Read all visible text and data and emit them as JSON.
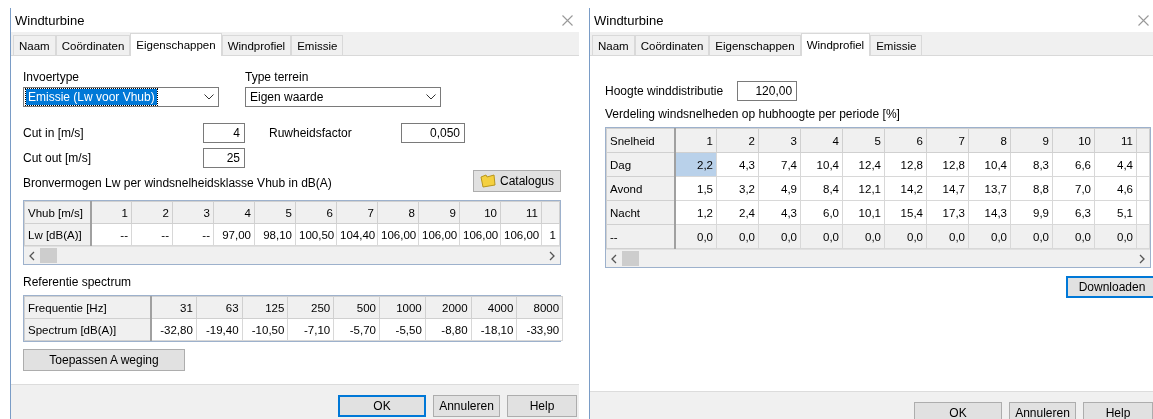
{
  "windows": [
    {
      "kind": "eigenschappen",
      "title": "Windturbine",
      "tabs": [
        {
          "label": "Naam",
          "selected": false
        },
        {
          "label": "Coördinaten",
          "selected": false
        },
        {
          "label": "Eigenschappen",
          "selected": true
        },
        {
          "label": "Windprofiel",
          "selected": false
        },
        {
          "label": "Emissie",
          "selected": false
        }
      ],
      "invoertype": {
        "label": "Invoertype",
        "value": "Emissie (Lw voor Vhub)",
        "focused": true
      },
      "type_terrein": {
        "label": "Type terrein",
        "value": "Eigen waarde",
        "focused": false
      },
      "cut_in": {
        "label": "Cut in [m/s]",
        "value": "4"
      },
      "ruwheidsfactor": {
        "label": "Ruwheidsfactor",
        "value": "0,050"
      },
      "cut_out": {
        "label": "Cut out [m/s]",
        "value": "25"
      },
      "bronvermogen_label": "Bronvermogen Lw per windsnelheidsklasse Vhub in dB(A)",
      "catalogus_button": "Catalogus",
      "lw_table": {
        "columns": [
          "Vhub [m/s]",
          "1",
          "2",
          "3",
          "4",
          "5",
          "6",
          "7",
          "8",
          "9",
          "10",
          "11"
        ],
        "rows": [
          {
            "label": "Lw [dB(A)]",
            "values": [
              "--",
              "--",
              "--",
              "97,00",
              "98,10",
              "100,50",
              "104,40",
              "106,00",
              "106,00",
              "106,00",
              "106,00",
              "1"
            ]
          }
        ]
      },
      "spectrum_label": "Referentie spectrum",
      "spectrum_table": {
        "columns": [
          "Frequentie [Hz]",
          "31",
          "63",
          "125",
          "250",
          "500",
          "1000",
          "2000",
          "4000",
          "8000"
        ],
        "rows": [
          {
            "label": "Spectrum [dB(A)]",
            "values": [
              "-32,80",
              "-19,40",
              "-10,50",
              "-7,10",
              "-5,70",
              "-5,50",
              "-8,80",
              "-18,10",
              "-33,90"
            ]
          }
        ]
      },
      "toepassen_button": "Toepassen A weging",
      "buttons": [
        {
          "label": "OK",
          "default": true
        },
        {
          "label": "Annuleren",
          "default": false
        },
        {
          "label": "Help",
          "default": false
        }
      ]
    },
    {
      "kind": "windprofiel",
      "title": "Windturbine",
      "tabs": [
        {
          "label": "Naam",
          "selected": false
        },
        {
          "label": "Coördinaten",
          "selected": false
        },
        {
          "label": "Eigenschappen",
          "selected": false
        },
        {
          "label": "Windprofiel",
          "selected": true
        },
        {
          "label": "Emissie",
          "selected": false
        }
      ],
      "hoogte": {
        "label": "Hoogte winddistributie",
        "value": "120,00"
      },
      "verdeling_label": "Verdeling windsnelheden op hubhoogte per periode [%]",
      "table": {
        "columns": [
          "Snelheid",
          "1",
          "2",
          "3",
          "4",
          "5",
          "6",
          "7",
          "8",
          "9",
          "10",
          "11"
        ],
        "rows": [
          {
            "label": "Dag",
            "kind": "data",
            "values": [
              {
                "text": "2,2",
                "selected": true
              },
              {
                "text": "4,3",
                "selected": false
              },
              {
                "text": "7,4",
                "selected": false
              },
              {
                "text": "10,4",
                "selected": false
              },
              {
                "text": "12,4",
                "selected": false
              },
              {
                "text": "12,8",
                "selected": false
              },
              {
                "text": "12,8",
                "selected": false
              },
              {
                "text": "10,4",
                "selected": false
              },
              {
                "text": "8,3",
                "selected": false
              },
              {
                "text": "6,6",
                "selected": false
              },
              {
                "text": "4,4",
                "selected": false
              }
            ]
          },
          {
            "label": "Avond",
            "kind": "data",
            "values": [
              {
                "text": "1,5",
                "selected": false
              },
              {
                "text": "3,2",
                "selected": false
              },
              {
                "text": "4,9",
                "selected": false
              },
              {
                "text": "8,4",
                "selected": false
              },
              {
                "text": "12,1",
                "selected": false
              },
              {
                "text": "14,2",
                "selected": false
              },
              {
                "text": "14,7",
                "selected": false
              },
              {
                "text": "13,7",
                "selected": false
              },
              {
                "text": "8,8",
                "selected": false
              },
              {
                "text": "7,0",
                "selected": false
              },
              {
                "text": "4,6",
                "selected": false
              }
            ]
          },
          {
            "label": "Nacht",
            "kind": "data",
            "values": [
              {
                "text": "1,2",
                "selected": false
              },
              {
                "text": "2,4",
                "selected": false
              },
              {
                "text": "4,3",
                "selected": false
              },
              {
                "text": "6,0",
                "selected": false
              },
              {
                "text": "10,1",
                "selected": false
              },
              {
                "text": "15,4",
                "selected": false
              },
              {
                "text": "17,3",
                "selected": false
              },
              {
                "text": "14,3",
                "selected": false
              },
              {
                "text": "9,9",
                "selected": false
              },
              {
                "text": "6,3",
                "selected": false
              },
              {
                "text": "5,1",
                "selected": false
              }
            ]
          },
          {
            "label": "--",
            "kind": "new",
            "values": [
              {
                "text": "0,0",
                "selected": false
              },
              {
                "text": "0,0",
                "selected": false
              },
              {
                "text": "0,0",
                "selected": false
              },
              {
                "text": "0,0",
                "selected": false
              },
              {
                "text": "0,0",
                "selected": false
              },
              {
                "text": "0,0",
                "selected": false
              },
              {
                "text": "0,0",
                "selected": false
              },
              {
                "text": "0,0",
                "selected": false
              },
              {
                "text": "0,0",
                "selected": false
              },
              {
                "text": "0,0",
                "selected": false
              },
              {
                "text": "0,0",
                "selected": false
              }
            ]
          }
        ]
      },
      "downloaden": {
        "label": "Downloaden",
        "focused": true
      },
      "buttons": [
        {
          "label": "OK",
          "default": false
        },
        {
          "label": "Annuleren",
          "default": false
        },
        {
          "label": "Help",
          "default": false
        }
      ]
    }
  ]
}
